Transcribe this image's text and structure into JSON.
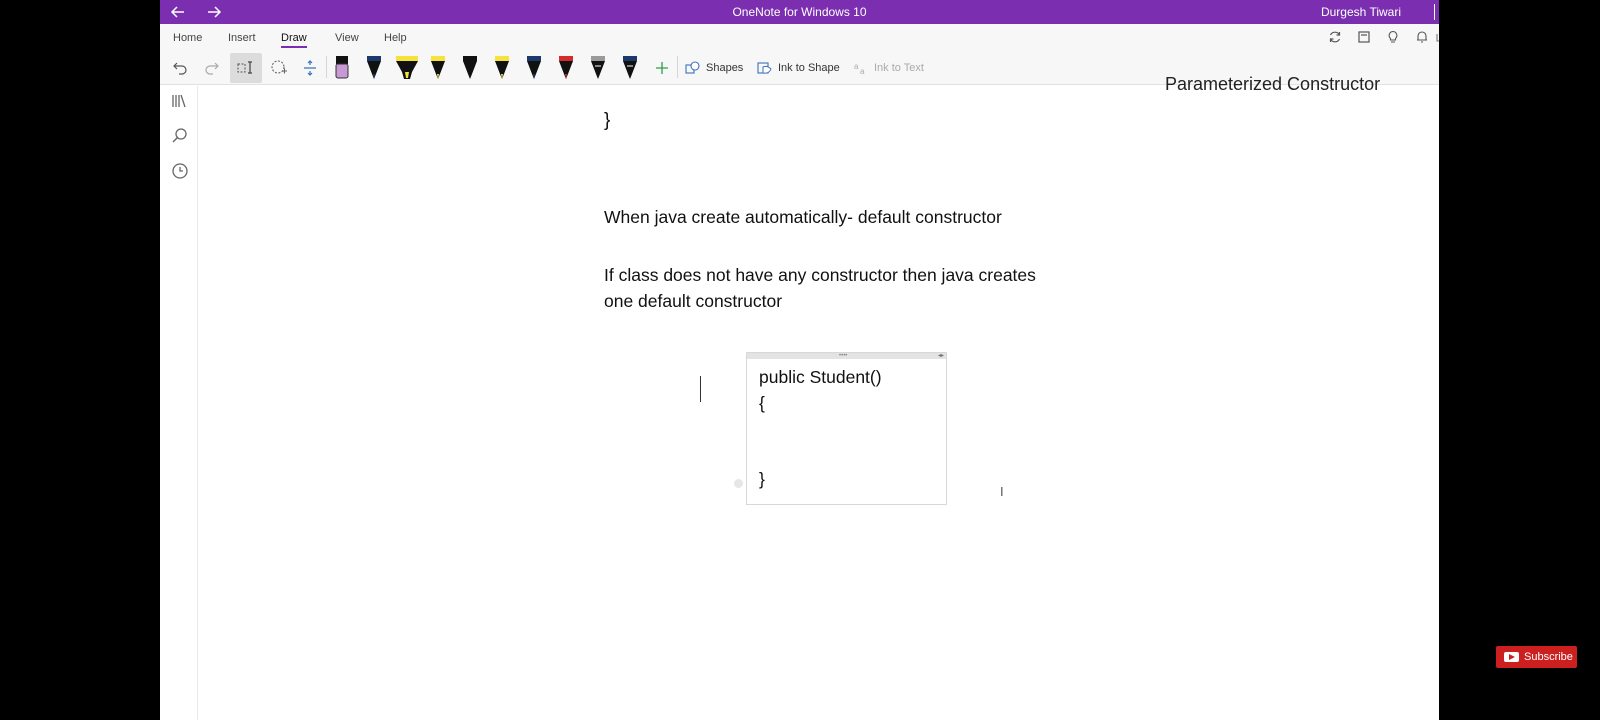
{
  "titlebar": {
    "back_icon": "arrow-left-icon",
    "forward_icon": "arrow-right-icon",
    "app_title": "OneNote for Windows 10",
    "user_name": "Durgesh Tiwari"
  },
  "ribbon": {
    "tabs": [
      {
        "label": "Home"
      },
      {
        "label": "Insert"
      },
      {
        "label": "Draw",
        "active": true
      },
      {
        "label": "View"
      },
      {
        "label": "Help"
      }
    ],
    "right_icons": [
      "sync-icon",
      "notebook-icon",
      "lightbulb-icon",
      "bell-icon",
      "more-icon"
    ],
    "tools": {
      "undo_icon": "undo-icon",
      "redo_icon": "redo-icon",
      "lasso_icon": "lasso-select-icon",
      "select_icon": "select-objects-icon",
      "space_icon": "add-space-icon",
      "add_pen_icon": "plus-icon",
      "shapes_label": "Shapes",
      "ink_to_shape_label": "Ink to Shape",
      "ink_to_text_label": "Ink to Text"
    },
    "pens": [
      {
        "kind": "eraser",
        "color": "#111111",
        "tip": "#c79ad6"
      },
      {
        "kind": "pen",
        "color": "#1a3a6e"
      },
      {
        "kind": "highlighter",
        "color": "#f5e23a"
      },
      {
        "kind": "pen",
        "color": "#f5e23a"
      },
      {
        "kind": "pen",
        "color": "#111111"
      },
      {
        "kind": "pen",
        "color": "#f5e23a"
      },
      {
        "kind": "pen",
        "color": "#1a3a6e"
      },
      {
        "kind": "pen",
        "color": "#d62b2b"
      },
      {
        "kind": "pen",
        "color": "#9a9a9a"
      },
      {
        "kind": "pen",
        "color": "#1a3a6e"
      }
    ]
  },
  "leftnav": {
    "icons": [
      "notebooks-icon",
      "search-icon",
      "recent-icon"
    ]
  },
  "page": {
    "cut_off_heading": "Parameterized Constructor",
    "closing_brace": "}",
    "line1": "When java create automatically- default constructor",
    "line2a": "If class does not have any constructor then java creates",
    "line2b": "one default constructor",
    "code_box": {
      "line1": "public Student()",
      "line2": "{",
      "line3": "}"
    }
  },
  "overlay": {
    "subscribe_label": "Subscribe"
  }
}
